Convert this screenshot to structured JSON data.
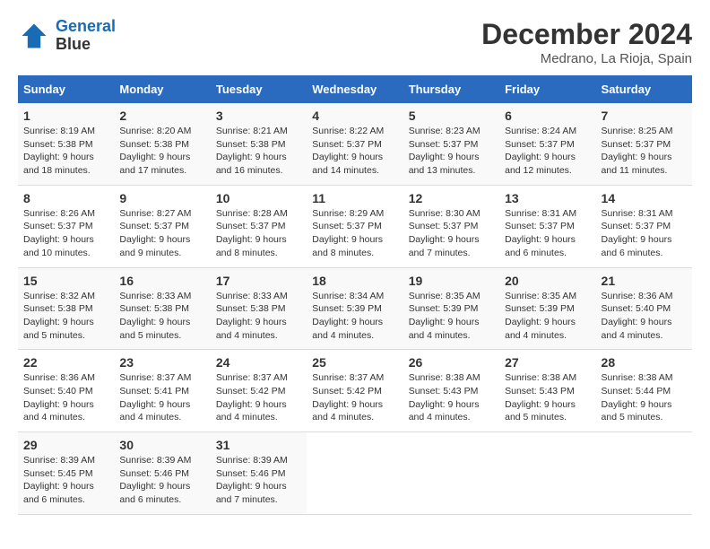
{
  "header": {
    "logo_line1": "General",
    "logo_line2": "Blue",
    "month": "December 2024",
    "location": "Medrano, La Rioja, Spain"
  },
  "days_of_week": [
    "Sunday",
    "Monday",
    "Tuesday",
    "Wednesday",
    "Thursday",
    "Friday",
    "Saturday"
  ],
  "weeks": [
    [
      {
        "day": "1",
        "sunrise": "8:19 AM",
        "sunset": "5:38 PM",
        "daylight": "9 hours and 18 minutes."
      },
      {
        "day": "2",
        "sunrise": "8:20 AM",
        "sunset": "5:38 PM",
        "daylight": "9 hours and 17 minutes."
      },
      {
        "day": "3",
        "sunrise": "8:21 AM",
        "sunset": "5:38 PM",
        "daylight": "9 hours and 16 minutes."
      },
      {
        "day": "4",
        "sunrise": "8:22 AM",
        "sunset": "5:37 PM",
        "daylight": "9 hours and 14 minutes."
      },
      {
        "day": "5",
        "sunrise": "8:23 AM",
        "sunset": "5:37 PM",
        "daylight": "9 hours and 13 minutes."
      },
      {
        "day": "6",
        "sunrise": "8:24 AM",
        "sunset": "5:37 PM",
        "daylight": "9 hours and 12 minutes."
      },
      {
        "day": "7",
        "sunrise": "8:25 AM",
        "sunset": "5:37 PM",
        "daylight": "9 hours and 11 minutes."
      }
    ],
    [
      {
        "day": "8",
        "sunrise": "8:26 AM",
        "sunset": "5:37 PM",
        "daylight": "9 hours and 10 minutes."
      },
      {
        "day": "9",
        "sunrise": "8:27 AM",
        "sunset": "5:37 PM",
        "daylight": "9 hours and 9 minutes."
      },
      {
        "day": "10",
        "sunrise": "8:28 AM",
        "sunset": "5:37 PM",
        "daylight": "9 hours and 8 minutes."
      },
      {
        "day": "11",
        "sunrise": "8:29 AM",
        "sunset": "5:37 PM",
        "daylight": "9 hours and 8 minutes."
      },
      {
        "day": "12",
        "sunrise": "8:30 AM",
        "sunset": "5:37 PM",
        "daylight": "9 hours and 7 minutes."
      },
      {
        "day": "13",
        "sunrise": "8:31 AM",
        "sunset": "5:37 PM",
        "daylight": "9 hours and 6 minutes."
      },
      {
        "day": "14",
        "sunrise": "8:31 AM",
        "sunset": "5:37 PM",
        "daylight": "9 hours and 6 minutes."
      }
    ],
    [
      {
        "day": "15",
        "sunrise": "8:32 AM",
        "sunset": "5:38 PM",
        "daylight": "9 hours and 5 minutes."
      },
      {
        "day": "16",
        "sunrise": "8:33 AM",
        "sunset": "5:38 PM",
        "daylight": "9 hours and 5 minutes."
      },
      {
        "day": "17",
        "sunrise": "8:33 AM",
        "sunset": "5:38 PM",
        "daylight": "9 hours and 4 minutes."
      },
      {
        "day": "18",
        "sunrise": "8:34 AM",
        "sunset": "5:39 PM",
        "daylight": "9 hours and 4 minutes."
      },
      {
        "day": "19",
        "sunrise": "8:35 AM",
        "sunset": "5:39 PM",
        "daylight": "9 hours and 4 minutes."
      },
      {
        "day": "20",
        "sunrise": "8:35 AM",
        "sunset": "5:39 PM",
        "daylight": "9 hours and 4 minutes."
      },
      {
        "day": "21",
        "sunrise": "8:36 AM",
        "sunset": "5:40 PM",
        "daylight": "9 hours and 4 minutes."
      }
    ],
    [
      {
        "day": "22",
        "sunrise": "8:36 AM",
        "sunset": "5:40 PM",
        "daylight": "9 hours and 4 minutes."
      },
      {
        "day": "23",
        "sunrise": "8:37 AM",
        "sunset": "5:41 PM",
        "daylight": "9 hours and 4 minutes."
      },
      {
        "day": "24",
        "sunrise": "8:37 AM",
        "sunset": "5:42 PM",
        "daylight": "9 hours and 4 minutes."
      },
      {
        "day": "25",
        "sunrise": "8:37 AM",
        "sunset": "5:42 PM",
        "daylight": "9 hours and 4 minutes."
      },
      {
        "day": "26",
        "sunrise": "8:38 AM",
        "sunset": "5:43 PM",
        "daylight": "9 hours and 4 minutes."
      },
      {
        "day": "27",
        "sunrise": "8:38 AM",
        "sunset": "5:43 PM",
        "daylight": "9 hours and 5 minutes."
      },
      {
        "day": "28",
        "sunrise": "8:38 AM",
        "sunset": "5:44 PM",
        "daylight": "9 hours and 5 minutes."
      }
    ],
    [
      {
        "day": "29",
        "sunrise": "8:39 AM",
        "sunset": "5:45 PM",
        "daylight": "9 hours and 6 minutes."
      },
      {
        "day": "30",
        "sunrise": "8:39 AM",
        "sunset": "5:46 PM",
        "daylight": "9 hours and 6 minutes."
      },
      {
        "day": "31",
        "sunrise": "8:39 AM",
        "sunset": "5:46 PM",
        "daylight": "9 hours and 7 minutes."
      },
      null,
      null,
      null,
      null
    ]
  ]
}
